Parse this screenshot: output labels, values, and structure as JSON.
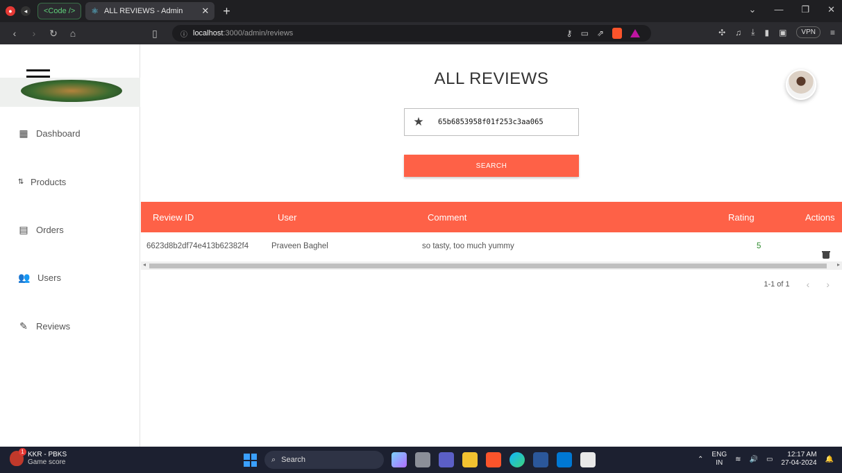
{
  "browser": {
    "tab_group_label": "<Code />",
    "tab_title": "ALL REVIEWS - Admin",
    "url_host": "localhost",
    "url_path": ":3000/admin/reviews",
    "vpn_label": "VPN"
  },
  "sidebar": {
    "items": [
      {
        "label": "Dashboard",
        "icon": "dashboard-icon"
      },
      {
        "label": "Products",
        "icon": "import-export-icon"
      },
      {
        "label": "Orders",
        "icon": "list-alt-icon"
      },
      {
        "label": "Users",
        "icon": "people-icon"
      },
      {
        "label": "Reviews",
        "icon": "rate-review-icon"
      }
    ]
  },
  "main": {
    "title": "ALL REVIEWS",
    "search_value": "65b6853958f01f253c3aa065",
    "search_button": "SEARCH",
    "columns": [
      "Review ID",
      "User",
      "Comment",
      "Rating",
      "Actions"
    ],
    "rows": [
      {
        "id": "6623d8b2df74e413b62382f4",
        "user": "Praveen Baghel",
        "comment": "so tasty, too much yummy",
        "rating": "5"
      }
    ],
    "pagination": "1-1 of 1"
  },
  "taskbar": {
    "score_title": "KKR - PBKS",
    "score_sub": "Game score",
    "badge": "1",
    "search_label": "Search",
    "lang_top": "ENG",
    "lang_bottom": "IN",
    "time": "12:17 AM",
    "date": "27-04-2024"
  },
  "colors": {
    "accent": "#fe6147",
    "rating_green": "#2e8b2e"
  }
}
